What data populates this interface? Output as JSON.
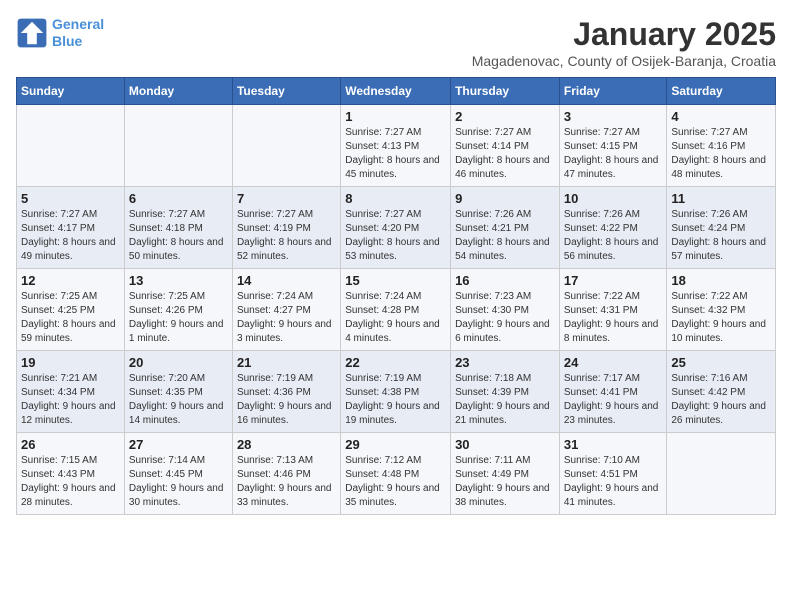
{
  "logo": {
    "line1": "General",
    "line2": "Blue"
  },
  "title": "January 2025",
  "subtitle": "Magadenovac, County of Osijek-Baranja, Croatia",
  "days_of_week": [
    "Sunday",
    "Monday",
    "Tuesday",
    "Wednesday",
    "Thursday",
    "Friday",
    "Saturday"
  ],
  "weeks": [
    [
      {
        "day": "",
        "sunrise": "",
        "sunset": "",
        "daylight": ""
      },
      {
        "day": "",
        "sunrise": "",
        "sunset": "",
        "daylight": ""
      },
      {
        "day": "",
        "sunrise": "",
        "sunset": "",
        "daylight": ""
      },
      {
        "day": "1",
        "sunrise": "Sunrise: 7:27 AM",
        "sunset": "Sunset: 4:13 PM",
        "daylight": "Daylight: 8 hours and 45 minutes."
      },
      {
        "day": "2",
        "sunrise": "Sunrise: 7:27 AM",
        "sunset": "Sunset: 4:14 PM",
        "daylight": "Daylight: 8 hours and 46 minutes."
      },
      {
        "day": "3",
        "sunrise": "Sunrise: 7:27 AM",
        "sunset": "Sunset: 4:15 PM",
        "daylight": "Daylight: 8 hours and 47 minutes."
      },
      {
        "day": "4",
        "sunrise": "Sunrise: 7:27 AM",
        "sunset": "Sunset: 4:16 PM",
        "daylight": "Daylight: 8 hours and 48 minutes."
      }
    ],
    [
      {
        "day": "5",
        "sunrise": "Sunrise: 7:27 AM",
        "sunset": "Sunset: 4:17 PM",
        "daylight": "Daylight: 8 hours and 49 minutes."
      },
      {
        "day": "6",
        "sunrise": "Sunrise: 7:27 AM",
        "sunset": "Sunset: 4:18 PM",
        "daylight": "Daylight: 8 hours and 50 minutes."
      },
      {
        "day": "7",
        "sunrise": "Sunrise: 7:27 AM",
        "sunset": "Sunset: 4:19 PM",
        "daylight": "Daylight: 8 hours and 52 minutes."
      },
      {
        "day": "8",
        "sunrise": "Sunrise: 7:27 AM",
        "sunset": "Sunset: 4:20 PM",
        "daylight": "Daylight: 8 hours and 53 minutes."
      },
      {
        "day": "9",
        "sunrise": "Sunrise: 7:26 AM",
        "sunset": "Sunset: 4:21 PM",
        "daylight": "Daylight: 8 hours and 54 minutes."
      },
      {
        "day": "10",
        "sunrise": "Sunrise: 7:26 AM",
        "sunset": "Sunset: 4:22 PM",
        "daylight": "Daylight: 8 hours and 56 minutes."
      },
      {
        "day": "11",
        "sunrise": "Sunrise: 7:26 AM",
        "sunset": "Sunset: 4:24 PM",
        "daylight": "Daylight: 8 hours and 57 minutes."
      }
    ],
    [
      {
        "day": "12",
        "sunrise": "Sunrise: 7:25 AM",
        "sunset": "Sunset: 4:25 PM",
        "daylight": "Daylight: 8 hours and 59 minutes."
      },
      {
        "day": "13",
        "sunrise": "Sunrise: 7:25 AM",
        "sunset": "Sunset: 4:26 PM",
        "daylight": "Daylight: 9 hours and 1 minute."
      },
      {
        "day": "14",
        "sunrise": "Sunrise: 7:24 AM",
        "sunset": "Sunset: 4:27 PM",
        "daylight": "Daylight: 9 hours and 3 minutes."
      },
      {
        "day": "15",
        "sunrise": "Sunrise: 7:24 AM",
        "sunset": "Sunset: 4:28 PM",
        "daylight": "Daylight: 9 hours and 4 minutes."
      },
      {
        "day": "16",
        "sunrise": "Sunrise: 7:23 AM",
        "sunset": "Sunset: 4:30 PM",
        "daylight": "Daylight: 9 hours and 6 minutes."
      },
      {
        "day": "17",
        "sunrise": "Sunrise: 7:22 AM",
        "sunset": "Sunset: 4:31 PM",
        "daylight": "Daylight: 9 hours and 8 minutes."
      },
      {
        "day": "18",
        "sunrise": "Sunrise: 7:22 AM",
        "sunset": "Sunset: 4:32 PM",
        "daylight": "Daylight: 9 hours and 10 minutes."
      }
    ],
    [
      {
        "day": "19",
        "sunrise": "Sunrise: 7:21 AM",
        "sunset": "Sunset: 4:34 PM",
        "daylight": "Daylight: 9 hours and 12 minutes."
      },
      {
        "day": "20",
        "sunrise": "Sunrise: 7:20 AM",
        "sunset": "Sunset: 4:35 PM",
        "daylight": "Daylight: 9 hours and 14 minutes."
      },
      {
        "day": "21",
        "sunrise": "Sunrise: 7:19 AM",
        "sunset": "Sunset: 4:36 PM",
        "daylight": "Daylight: 9 hours and 16 minutes."
      },
      {
        "day": "22",
        "sunrise": "Sunrise: 7:19 AM",
        "sunset": "Sunset: 4:38 PM",
        "daylight": "Daylight: 9 hours and 19 minutes."
      },
      {
        "day": "23",
        "sunrise": "Sunrise: 7:18 AM",
        "sunset": "Sunset: 4:39 PM",
        "daylight": "Daylight: 9 hours and 21 minutes."
      },
      {
        "day": "24",
        "sunrise": "Sunrise: 7:17 AM",
        "sunset": "Sunset: 4:41 PM",
        "daylight": "Daylight: 9 hours and 23 minutes."
      },
      {
        "day": "25",
        "sunrise": "Sunrise: 7:16 AM",
        "sunset": "Sunset: 4:42 PM",
        "daylight": "Daylight: 9 hours and 26 minutes."
      }
    ],
    [
      {
        "day": "26",
        "sunrise": "Sunrise: 7:15 AM",
        "sunset": "Sunset: 4:43 PM",
        "daylight": "Daylight: 9 hours and 28 minutes."
      },
      {
        "day": "27",
        "sunrise": "Sunrise: 7:14 AM",
        "sunset": "Sunset: 4:45 PM",
        "daylight": "Daylight: 9 hours and 30 minutes."
      },
      {
        "day": "28",
        "sunrise": "Sunrise: 7:13 AM",
        "sunset": "Sunset: 4:46 PM",
        "daylight": "Daylight: 9 hours and 33 minutes."
      },
      {
        "day": "29",
        "sunrise": "Sunrise: 7:12 AM",
        "sunset": "Sunset: 4:48 PM",
        "daylight": "Daylight: 9 hours and 35 minutes."
      },
      {
        "day": "30",
        "sunrise": "Sunrise: 7:11 AM",
        "sunset": "Sunset: 4:49 PM",
        "daylight": "Daylight: 9 hours and 38 minutes."
      },
      {
        "day": "31",
        "sunrise": "Sunrise: 7:10 AM",
        "sunset": "Sunset: 4:51 PM",
        "daylight": "Daylight: 9 hours and 41 minutes."
      },
      {
        "day": "",
        "sunrise": "",
        "sunset": "",
        "daylight": ""
      }
    ]
  ]
}
